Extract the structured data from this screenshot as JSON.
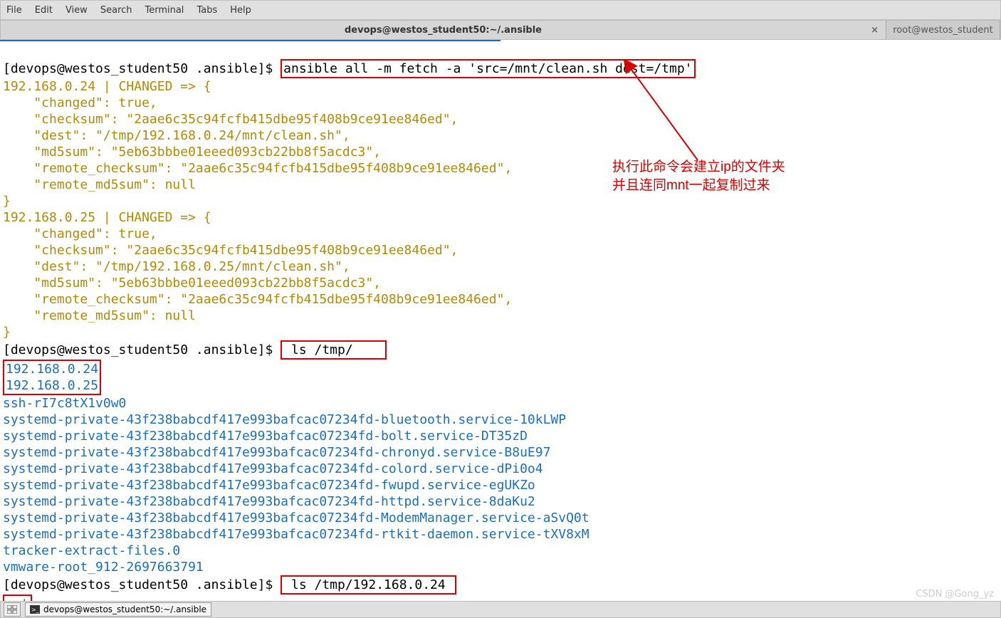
{
  "menu": [
    "File",
    "Edit",
    "View",
    "Search",
    "Terminal",
    "Tabs",
    "Help"
  ],
  "tabs": {
    "active": "devops@westos_student50:~/.ansible",
    "inactive": "root@westos_student"
  },
  "prompt": "[devops@westos_student50 .ansible]$ ",
  "cmd1": "ansible all -m fetch -a 'src=/mnt/clean.sh dest=/tmp'",
  "out1": [
    "192.168.0.24 | CHANGED => {",
    "    \"changed\": true,",
    "    \"checksum\": \"2aae6c35c94fcfb415dbe95f408b9ce91ee846ed\",",
    "    \"dest\": \"/tmp/192.168.0.24/mnt/clean.sh\",",
    "    \"md5sum\": \"5eb63bbbe01eeed093cb22bb8f5acdc3\",",
    "    \"remote_checksum\": \"2aae6c35c94fcfb415dbe95f408b9ce91ee846ed\",",
    "    \"remote_md5sum\": null",
    "}",
    "192.168.0.25 | CHANGED => {",
    "    \"changed\": true,",
    "    \"checksum\": \"2aae6c35c94fcfb415dbe95f408b9ce91ee846ed\",",
    "    \"dest\": \"/tmp/192.168.0.25/mnt/clean.sh\",",
    "    \"md5sum\": \"5eb63bbbe01eeed093cb22bb8f5acdc3\",",
    "    \"remote_checksum\": \"2aae6c35c94fcfb415dbe95f408b9ce91ee846ed\",",
    "    \"remote_md5sum\": null",
    "}"
  ],
  "cmd2": "ls /tmp/",
  "ls_ip": [
    "192.168.0.24",
    "192.168.0.25"
  ],
  "ls_rest": [
    "ssh-rI7c8tX1v0w0",
    "systemd-private-43f238babcdf417e993bafcac07234fd-bluetooth.service-10kLWP",
    "systemd-private-43f238babcdf417e993bafcac07234fd-bolt.service-DT35zD",
    "systemd-private-43f238babcdf417e993bafcac07234fd-chronyd.service-B8uE97",
    "systemd-private-43f238babcdf417e993bafcac07234fd-colord.service-dPi0o4",
    "systemd-private-43f238babcdf417e993bafcac07234fd-fwupd.service-egUKZo",
    "systemd-private-43f238babcdf417e993bafcac07234fd-httpd.service-8daKu2",
    "systemd-private-43f238babcdf417e993bafcac07234fd-ModemManager.service-aSvQ0t",
    "systemd-private-43f238babcdf417e993bafcac07234fd-rtkit-daemon.service-tXV8xM",
    "tracker-extract-files.0",
    "vmware-root_912-2697663791"
  ],
  "cmd3": "ls /tmp/192.168.0.24",
  "out3": "mnt",
  "annot1": "执行此命令会建立ip的文件夹",
  "annot2": "并且连同mnt一起复制过来",
  "bottombar_title": "devops@westos_student50:~/.ansible",
  "watermark": "CSDN @Gong_yz"
}
